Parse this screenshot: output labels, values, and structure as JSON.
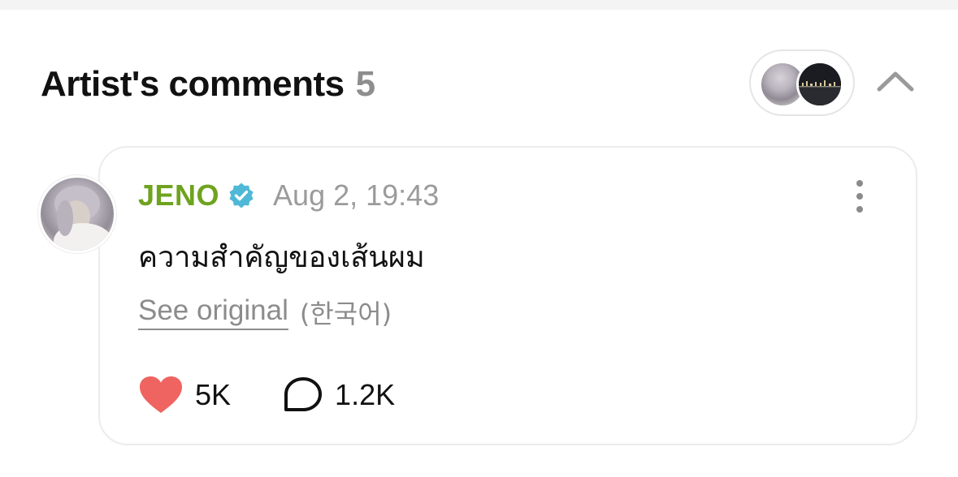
{
  "header": {
    "title": "Artist's comments",
    "count": "5"
  },
  "avatar_group": {
    "avatars": [
      "avatar",
      "avatar"
    ]
  },
  "icons": {
    "collapse": "chevron-up-icon",
    "verified": "verified-badge-icon",
    "more": "more-vertical-icon",
    "like": "heart-icon",
    "comment": "comment-bubble-icon"
  },
  "comment": {
    "author": "JENO",
    "timestamp": "Aug 2, 19:43",
    "text": "ความสำคัญของเส้นผม",
    "see_original": "See original",
    "original_language": "(한국어)",
    "likes": "5K",
    "replies": "1.2K"
  },
  "colors": {
    "author_name": "#6fa31f",
    "verified_badge": "#4fb8d6",
    "heart": "#ef6461",
    "muted_text": "#8c8c8c"
  }
}
